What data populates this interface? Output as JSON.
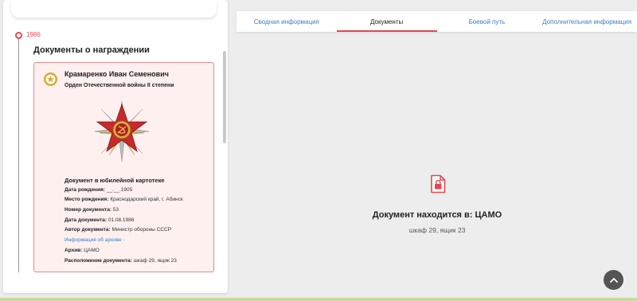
{
  "timeline": {
    "year": "1986",
    "section_title": "Документы о награждении"
  },
  "card": {
    "person_name": "Крамаренко Иван Семенович",
    "award_name": "Орден Отечественной войны II степени",
    "doc_title": "Документ в юбилейной картотеке",
    "fields": [
      {
        "label": "Дата рождения:",
        "value": "__.__.1905"
      },
      {
        "label": "Место рождения:",
        "value": "Краснодарский край, г. Абинск"
      },
      {
        "label": "Номер документа:",
        "value": "53"
      },
      {
        "label": "Дата документа:",
        "value": "01.08.1986"
      },
      {
        "label": "Автор документа:",
        "value": "Министр обороны СССР"
      }
    ],
    "archive_link": "Информация об архиве",
    "archive": {
      "label": "Архив:",
      "value": "ЦАМО"
    },
    "location": {
      "label": "Расположение документа:",
      "value": "шкаф 29, ящик 23"
    },
    "icons": {
      "award": "award-badge-icon",
      "medal": "order-star-medal"
    }
  },
  "tabs": [
    {
      "label": "Сводная информация",
      "active": false
    },
    {
      "label": "Документы",
      "active": true
    },
    {
      "label": "Боевой путь",
      "active": false
    },
    {
      "label": "Дополнительная информация",
      "active": false
    }
  ],
  "document_panel": {
    "location": "Документ находится в: ЦАМО",
    "shelf": "шкаф 29, ящик 23",
    "icon": "locked-document-icon"
  },
  "colors": {
    "accent": "#e2484f",
    "link": "#3b82c4",
    "card_bg": "#fdf0ef",
    "card_border": "#e58a8a"
  }
}
